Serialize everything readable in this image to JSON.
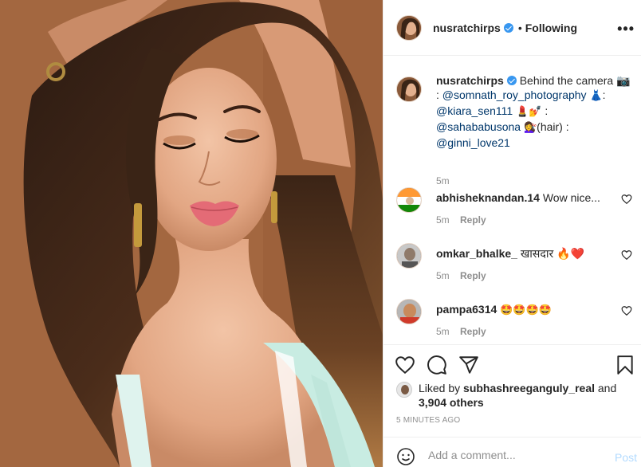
{
  "post": {
    "author": "nusratchirps",
    "separator": "•",
    "follow_status": "Following",
    "more_label": "•••"
  },
  "caption": {
    "username": "nusratchirps",
    "text_intro": "Behind the camera 📷",
    "sep1": ":",
    "mention_photographer": "@somnath_roy_photography",
    "emoji_dress": "👗",
    "sep2": ":",
    "mention_makeup": "@kiara_sen111",
    "emoji_makeup": "💄💅",
    "sep3": ":",
    "mention_hair": "@sahababusona",
    "emoji_hair": "💇‍♀️",
    "hair_label": "(hair) :",
    "mention_styling": "@ginni_love21",
    "time": "5m"
  },
  "comments": [
    {
      "username": "abhisheknandan.14",
      "text": "Wow nice...",
      "time": "5m",
      "reply_label": "Reply"
    },
    {
      "username": "omkar_bhalke_",
      "text": "खासदार 🔥❤️",
      "time": "5m",
      "reply_label": "Reply"
    },
    {
      "username": "pampa6314",
      "text": "🤩🤩🤩🤩",
      "time": "5m",
      "reply_label": "Reply"
    }
  ],
  "likes": {
    "prefix": "Liked by",
    "liker": "subhashreeganguly_real",
    "conjunction": "and",
    "others": "3,904 others"
  },
  "time_ago": "5 MINUTES AGO",
  "add_comment": {
    "placeholder": "Add a comment...",
    "post_label": "Post"
  },
  "icons": {
    "like": "heart-icon",
    "comment": "comment-icon",
    "share": "share-icon",
    "save": "bookmark-icon",
    "emoji": "smile-icon",
    "options": "more-icon"
  },
  "colors": {
    "verified": "#3897f0",
    "mention": "#00376b",
    "muted": "#8e8e8e",
    "post_button": "#b3dbff"
  }
}
